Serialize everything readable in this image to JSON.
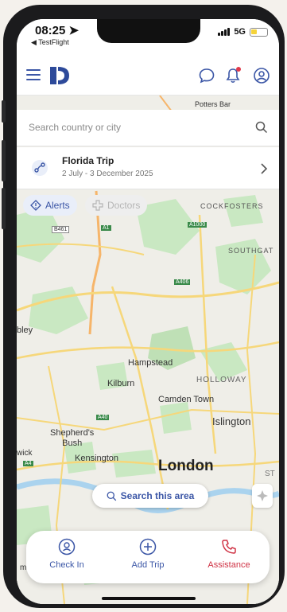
{
  "status": {
    "time": "08:25",
    "back_app": "TestFlight",
    "network": "5G"
  },
  "search": {
    "placeholder": "Search country or city"
  },
  "trip": {
    "title": "Florida Trip",
    "dates": "2 July - 3 December 2025"
  },
  "filters": [
    {
      "label": "Alerts",
      "active": true
    },
    {
      "label": "Doctors",
      "active": false
    }
  ],
  "map_labels": {
    "potters_bar": "Potters Bar",
    "cockfosters": "COCKFOSTERS",
    "southgate": "SOUTHGAT",
    "hampstead": "Hampstead",
    "kilburn": "Kilburn",
    "holloway": "HOLLOWAY",
    "camden": "Camden Town",
    "islington": "Islington",
    "shepherds_bush": "Shepherd's\nBush",
    "kensington": "Kensington",
    "london": "London",
    "wick": "wick",
    "wembley": "bley",
    "wimbledon": "mbledon",
    "st": "ST",
    "road_b461": "B461",
    "road_a1": "A1",
    "road_a1000": "A1000",
    "road_a406": "A406",
    "road_a40": "A40",
    "road_a4": "A4"
  },
  "search_area": {
    "label": "Search this area"
  },
  "bottom_nav": [
    {
      "label": "Check In",
      "icon": "check-in-icon"
    },
    {
      "label": "Add Trip",
      "icon": "add-trip-icon"
    },
    {
      "label": "Assistance",
      "icon": "phone-icon"
    }
  ],
  "colors": {
    "brand": "#3b56a6",
    "assistance": "#cf3244",
    "notification": "#e0394a",
    "water": "#aad3ee",
    "park": "#c9e8c2",
    "road": "#f6d77a"
  }
}
